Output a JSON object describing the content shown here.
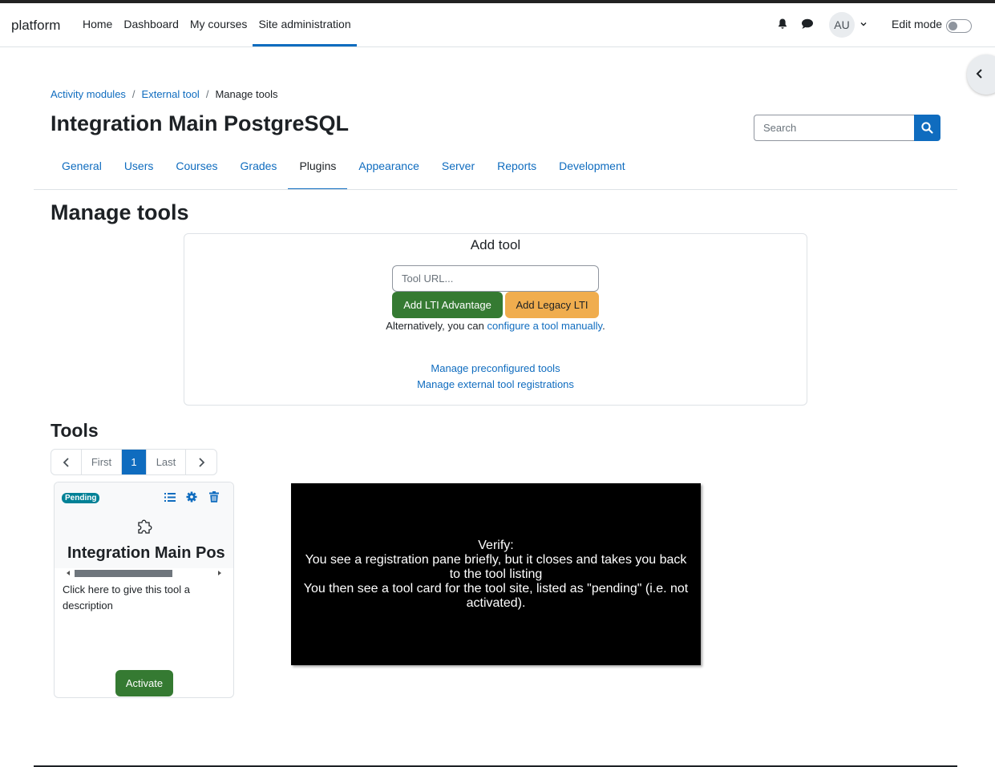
{
  "navbar": {
    "brand": "platform",
    "links": [
      "Home",
      "Dashboard",
      "My courses",
      "Site administration"
    ],
    "active_link": "Site administration",
    "avatar_initials": "AU",
    "edit_mode_label": "Edit mode",
    "edit_mode_on": false,
    "icons": [
      "bell-icon",
      "chat-icon",
      "chevron-down-icon"
    ]
  },
  "breadcrumb": {
    "items": [
      "Activity modules",
      "External tool"
    ],
    "current": "Manage tools"
  },
  "header": {
    "title": "Integration Main PostgreSQL",
    "search_placeholder": "Search"
  },
  "secondary_nav": {
    "tabs": [
      "General",
      "Users",
      "Courses",
      "Grades",
      "Plugins",
      "Appearance",
      "Server",
      "Reports",
      "Development"
    ],
    "active_tab": "Plugins"
  },
  "main": {
    "heading": "Manage tools",
    "add_tool": {
      "title": "Add tool",
      "url_placeholder": "Tool URL...",
      "lti_advantage_label": "Add LTI Advantage",
      "legacy_label": "Add Legacy LTI",
      "alt_prefix": "Alternatively, you can ",
      "alt_link": "configure a tool manually",
      "alt_suffix": ".",
      "link_preconfigured": "Manage preconfigured tools",
      "link_registrations": "Manage external tool registrations"
    },
    "tools_heading": "Tools",
    "pagination": {
      "first": "First",
      "current": "1",
      "last": "Last"
    },
    "tool_card": {
      "badge": "Pending",
      "name": "Integration Main Pos",
      "description": "Click here to give this tool a description",
      "activate_label": "Activate"
    }
  },
  "overlay": {
    "lines": [
      "Verify:",
      "You see a registration pane briefly, but it closes and takes you back to the tool listing",
      "You then see a tool card for the tool site, listed as \"pending\" (i.e. not activated)."
    ]
  },
  "colors": {
    "primary": "#0f6cbf",
    "success": "#357a32",
    "warning": "#f0ad4e",
    "badge_pending": "#008196"
  }
}
